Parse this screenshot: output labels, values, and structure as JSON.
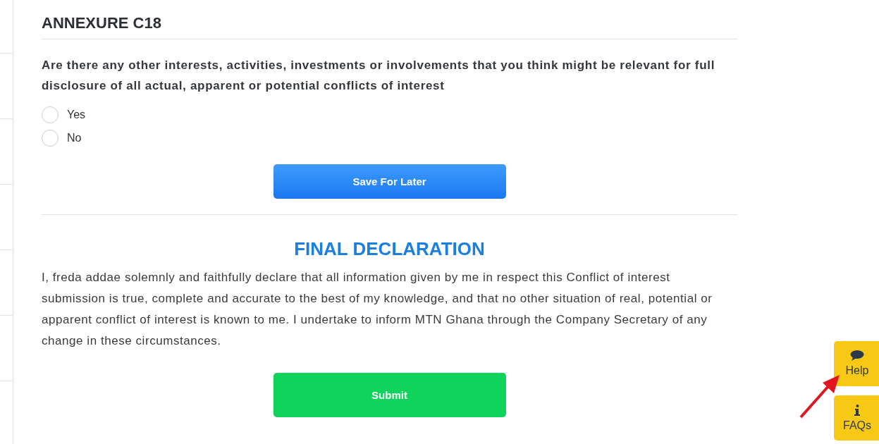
{
  "annexure": {
    "title": "ANNEXURE C18",
    "question": "Are there any other interests, activities, investments or involvements that you think might be relevant for full disclosure of all actual, apparent or potential conflicts of interest",
    "options": [
      {
        "label": "Yes",
        "selected": false
      },
      {
        "label": "No",
        "selected": false
      }
    ],
    "save_button": "Save For Later"
  },
  "declaration": {
    "title": "FINAL DECLARATION",
    "text": "I, freda addae solemnly and faithfully declare that all information given by me in respect this Conflict of interest submission is true, complete and accurate to the best of my knowledge, and that no other situation of real, potential or apparent conflict of interest is known to me. I undertake to inform MTN Ghana through the Company Secretary of any change in these circumstances.",
    "submit_button": "Submit"
  },
  "side_tabs": [
    {
      "kind": "help",
      "label": "Help"
    },
    {
      "kind": "faq",
      "label": "FAQs"
    }
  ]
}
